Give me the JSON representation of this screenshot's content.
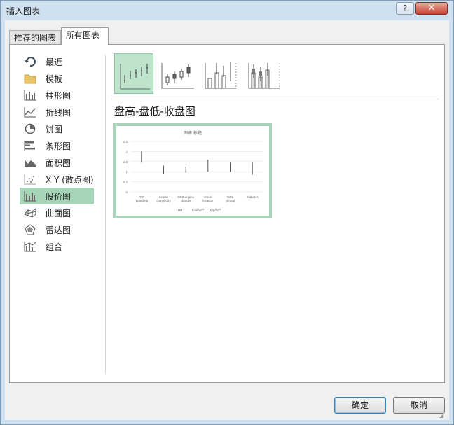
{
  "window": {
    "title": "插入图表",
    "help_label": "?",
    "close_label": "✕"
  },
  "tabs": [
    {
      "label": "推荐的图表",
      "selected": false
    },
    {
      "label": "所有图表",
      "selected": true
    }
  ],
  "sidebar": {
    "items": [
      {
        "label": "最近",
        "icon": "recent-icon",
        "selected": false
      },
      {
        "label": "模板",
        "icon": "folder-icon",
        "selected": false
      },
      {
        "label": "柱形图",
        "icon": "column-chart-icon",
        "selected": false
      },
      {
        "label": "折线图",
        "icon": "line-chart-icon",
        "selected": false
      },
      {
        "label": "饼图",
        "icon": "pie-chart-icon",
        "selected": false
      },
      {
        "label": "条形图",
        "icon": "bar-chart-icon",
        "selected": false
      },
      {
        "label": "面积图",
        "icon": "area-chart-icon",
        "selected": false
      },
      {
        "label": "X Y (散点图)",
        "icon": "scatter-chart-icon",
        "selected": false
      },
      {
        "label": "股价图",
        "icon": "stock-chart-icon",
        "selected": true
      },
      {
        "label": "曲面图",
        "icon": "surface-chart-icon",
        "selected": false
      },
      {
        "label": "雷达图",
        "icon": "radar-chart-icon",
        "selected": false
      },
      {
        "label": "组合",
        "icon": "combo-chart-icon",
        "selected": false
      }
    ]
  },
  "subtypes": [
    {
      "icon": "high-low-close-icon",
      "selected": true
    },
    {
      "icon": "open-high-low-close-icon",
      "selected": false
    },
    {
      "icon": "volume-high-low-close-icon",
      "selected": false
    },
    {
      "icon": "volume-open-high-low-close-icon",
      "selected": false
    }
  ],
  "selected_type_title": "盘高-盘低-收盘图",
  "preview": {
    "chart_data": {
      "type": "bar",
      "title": "图表 标题",
      "categories": [
        "FFR (quartile p",
        "Lesion complexity",
        "CCS angina class III",
        "Vessel location",
        "%DS (strata)",
        "Diabetes"
      ],
      "series": [
        {
          "name": "HR",
          "values": [
            1.45,
            1.05,
            1.05,
            1.25,
            1.15,
            1.1
          ]
        },
        {
          "name": "LowerCI",
          "values": [
            1.45,
            0.9,
            0.95,
            1.0,
            1.0,
            0.85
          ]
        },
        {
          "name": "UpperCI",
          "values": [
            2.0,
            1.3,
            1.25,
            1.6,
            1.45,
            1.45
          ]
        }
      ],
      "y_ticks": [
        "0",
        "0.5",
        "1",
        "1.5",
        "2",
        "2.5"
      ],
      "ylim": [
        0,
        2.5
      ],
      "legend": "bottom",
      "grid": true
    }
  },
  "buttons": {
    "ok": "确定",
    "cancel": "取消"
  },
  "colors": {
    "selected_green": "#a6d4b6",
    "preview_border": "#a9d3bb"
  }
}
